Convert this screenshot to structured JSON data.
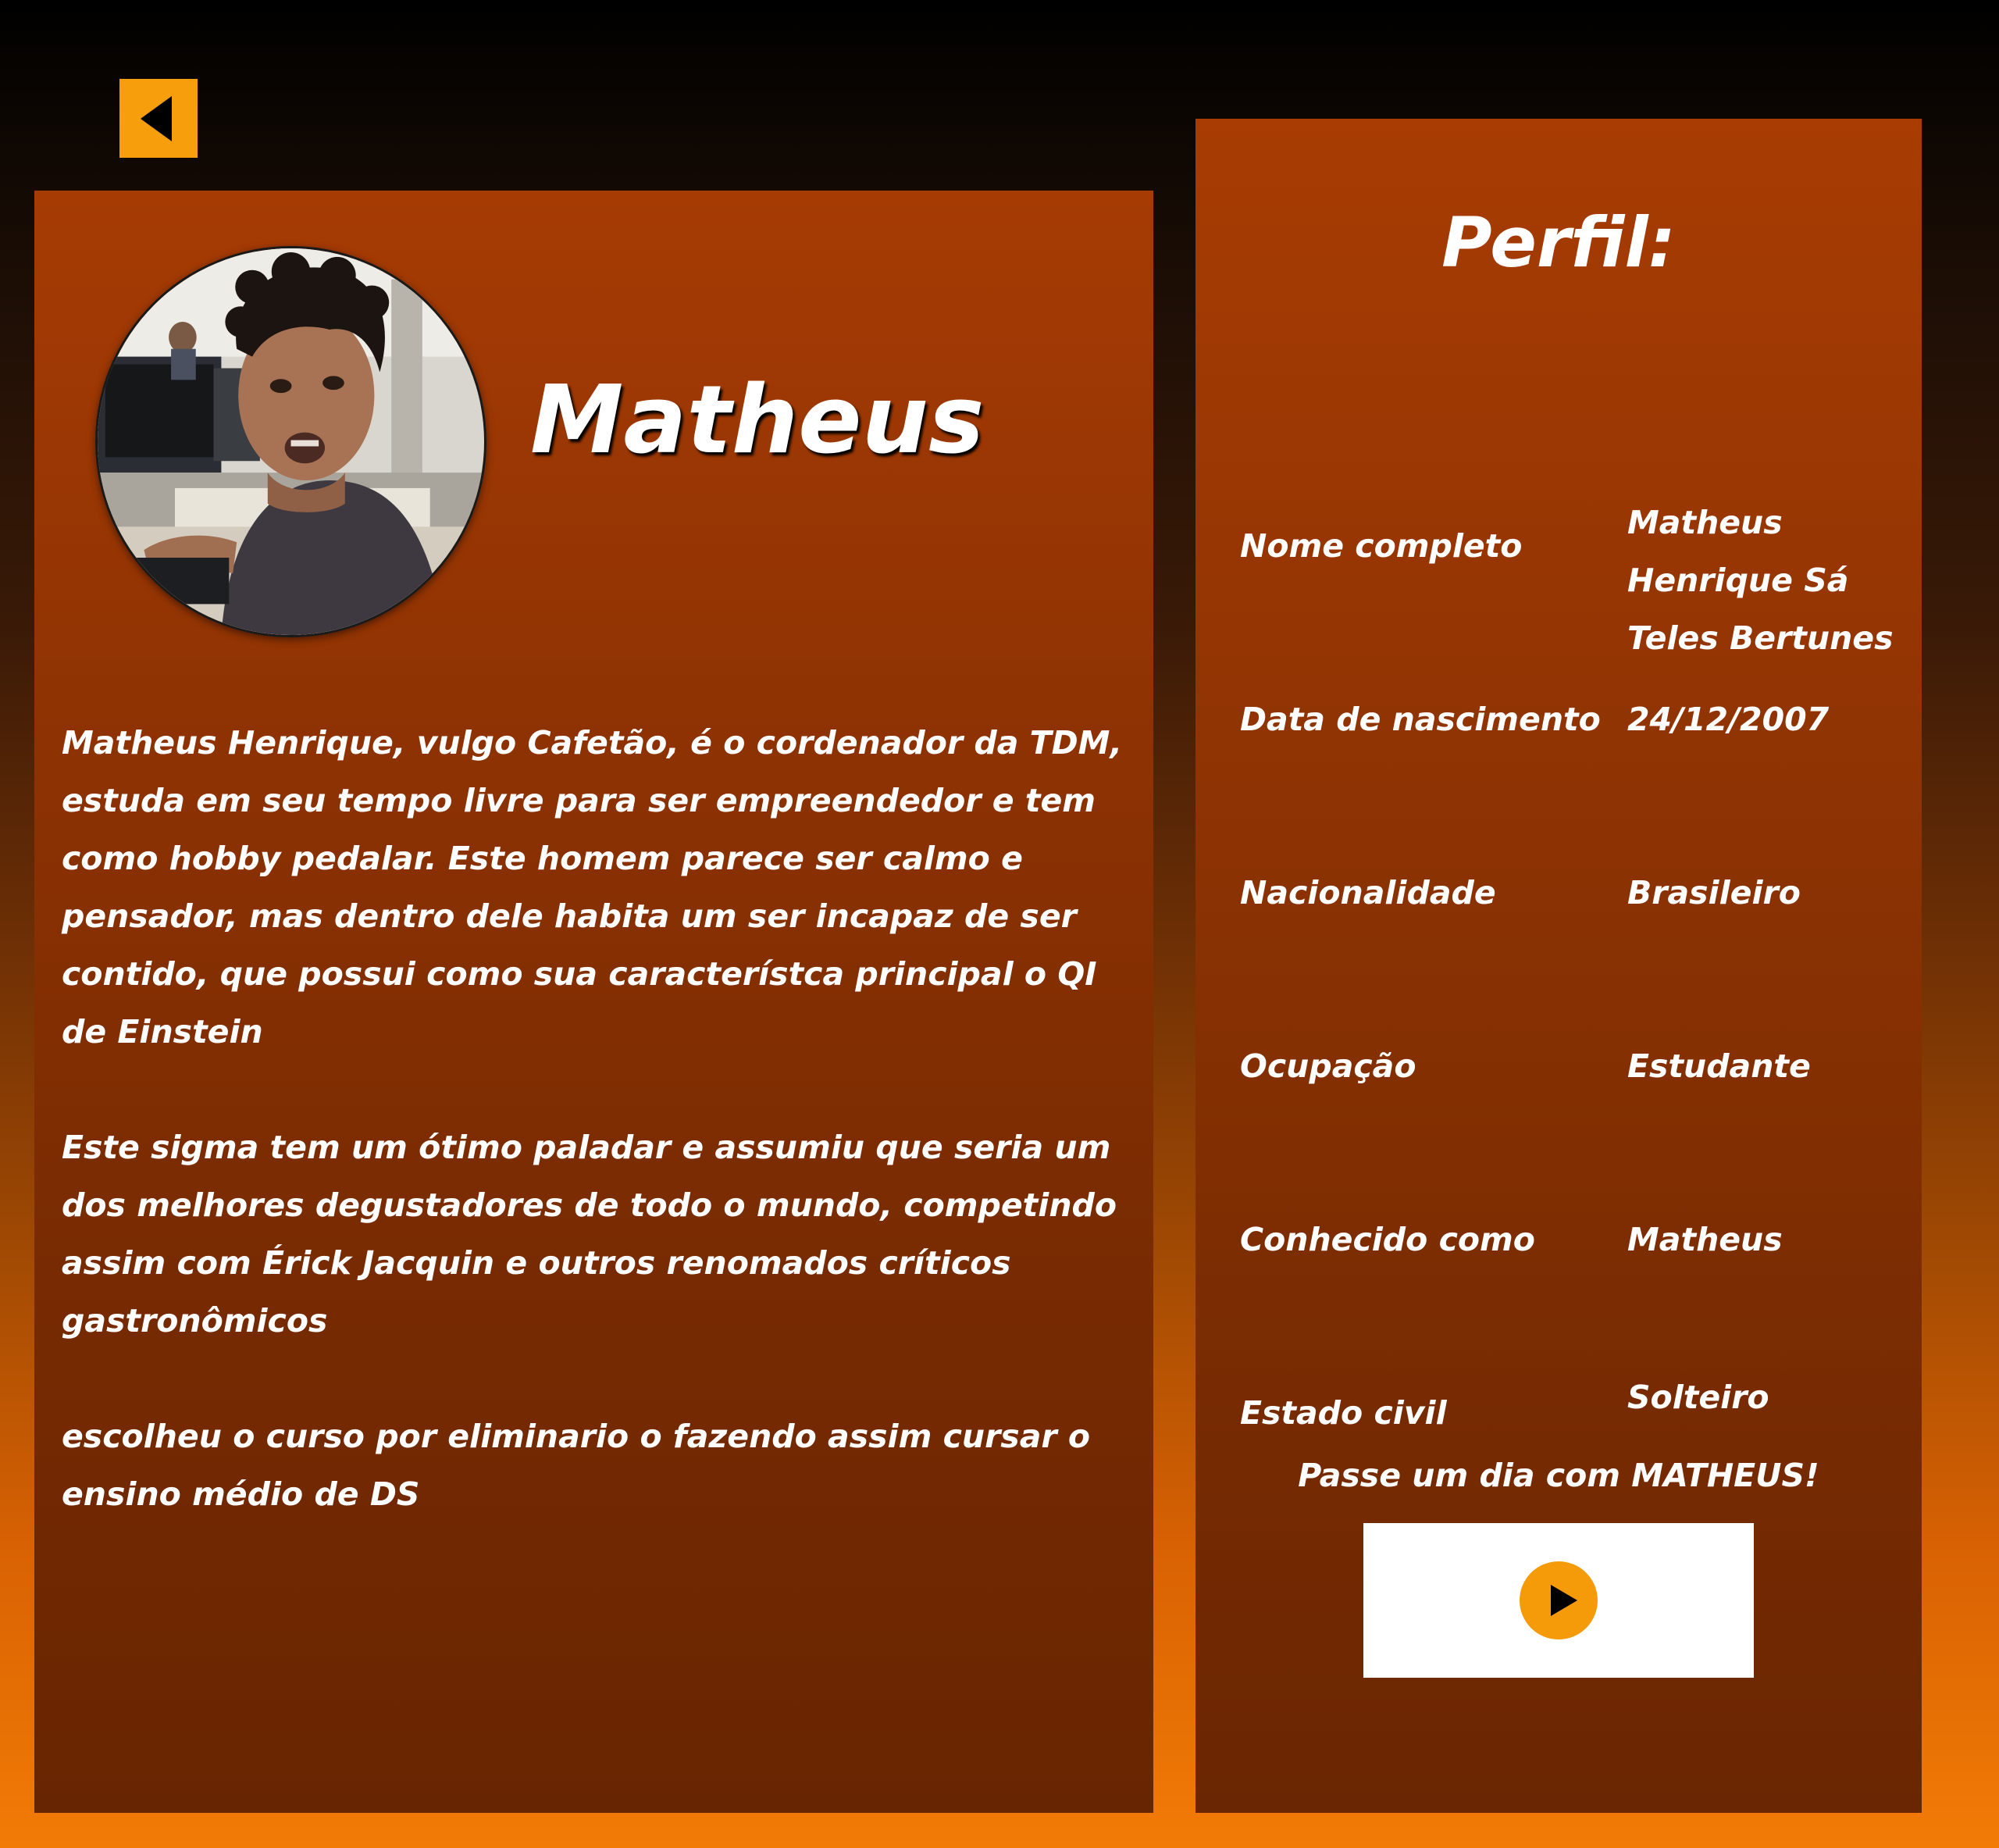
{
  "nav": {
    "back_icon": "triangle-left-icon",
    "back_color": "#f69e0b"
  },
  "profile": {
    "name": "Matheus",
    "avatar_alt": "Matheus",
    "bio": [
      "Matheus Henrique, vulgo Cafetão, é o cordenador da TDM, estuda em seu tempo livre para ser empreendedor e tem como hobby pedalar. Este homem parece ser calmo e pensador, mas dentro dele habita um ser incapaz de ser contido, que possui como sua característca principal o QI de Einstein",
      "Este sigma tem um ótimo paladar e assumiu que seria um dos melhores degustadores de todo o mundo, competindo assim com Érick Jacquin e outros renomados críticos gastronômicos",
      "escolheu o curso por eliminario o fazendo assim cursar o ensino médio de DS"
    ]
  },
  "perfil": {
    "title": "Perfil:",
    "rows": [
      {
        "label": "Nome completo",
        "value_lines": [
          "Matheus",
          "Henrique Sá",
          "Teles Bertunes"
        ]
      },
      {
        "label": "Data de nascimento",
        "value_lines": [
          "24/12/2007"
        ]
      },
      {
        "label": "Nacionalidade",
        "value_lines": [
          "Brasileiro"
        ]
      },
      {
        "label": "Ocupação",
        "value_lines": [
          "Estudante"
        ]
      },
      {
        "label": "Conhecido como",
        "value_lines": [
          "Matheus"
        ]
      },
      {
        "label": "Estado civil",
        "value_lines": [
          "Solteiro"
        ]
      }
    ],
    "cta": "Passe um dia com MATHEUS!",
    "play_icon": "play-icon",
    "play_color": "#f59b0a"
  }
}
